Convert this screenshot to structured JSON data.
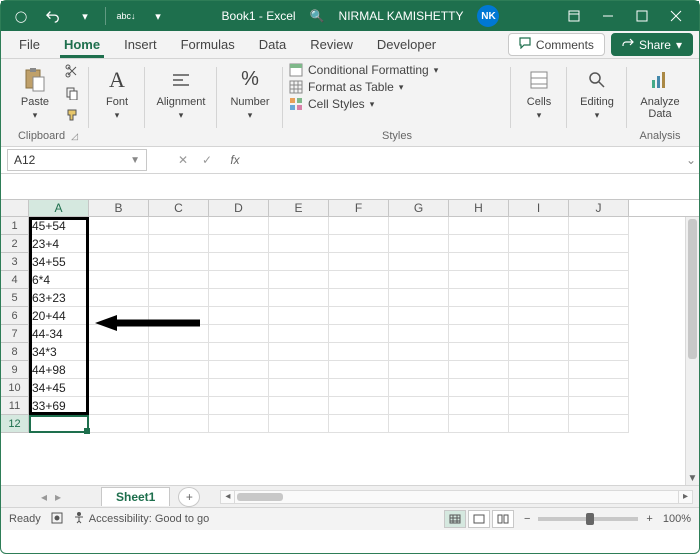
{
  "titlebar": {
    "doc_title": "Book1 - Excel",
    "user_name": "NIRMAL KAMISHETTY",
    "user_initials": "NK",
    "search_icon": "🔍"
  },
  "tabs": {
    "file": "File",
    "home": "Home",
    "insert": "Insert",
    "formulas": "Formulas",
    "data": "Data",
    "review": "Review",
    "developer": "Developer",
    "comments": "Comments",
    "share": "Share"
  },
  "ribbon": {
    "clipboard": {
      "paste": "Paste",
      "label": "Clipboard"
    },
    "font": {
      "label": "Font",
      "btn": "Font"
    },
    "alignment": {
      "label": "",
      "btn": "Alignment"
    },
    "number": {
      "label": "",
      "btn": "Number"
    },
    "styles": {
      "cond": "Conditional Formatting",
      "fmt_table": "Format as Table",
      "cell_styles": "Cell Styles",
      "label": "Styles"
    },
    "cells": {
      "btn": "Cells"
    },
    "editing": {
      "btn": "Editing"
    },
    "analysis": {
      "btn": "Analyze Data",
      "label": "Analysis"
    }
  },
  "namebox": {
    "value": "A12"
  },
  "columns": [
    "A",
    "B",
    "C",
    "D",
    "E",
    "F",
    "G",
    "H",
    "I",
    "J"
  ],
  "rows": [
    "1",
    "2",
    "3",
    "4",
    "5",
    "6",
    "7",
    "8",
    "9",
    "10",
    "11",
    "12"
  ],
  "cells_a": [
    "45+54",
    "23+4",
    "34+55",
    "6*4",
    "63+23",
    "20+44",
    "44-34",
    "34*3",
    "44+98",
    "34+45",
    "33+69",
    ""
  ],
  "sheet": {
    "name": "Sheet1"
  },
  "status": {
    "ready": "Ready",
    "accessibility": "Accessibility: Good to go",
    "zoom": "100%"
  }
}
